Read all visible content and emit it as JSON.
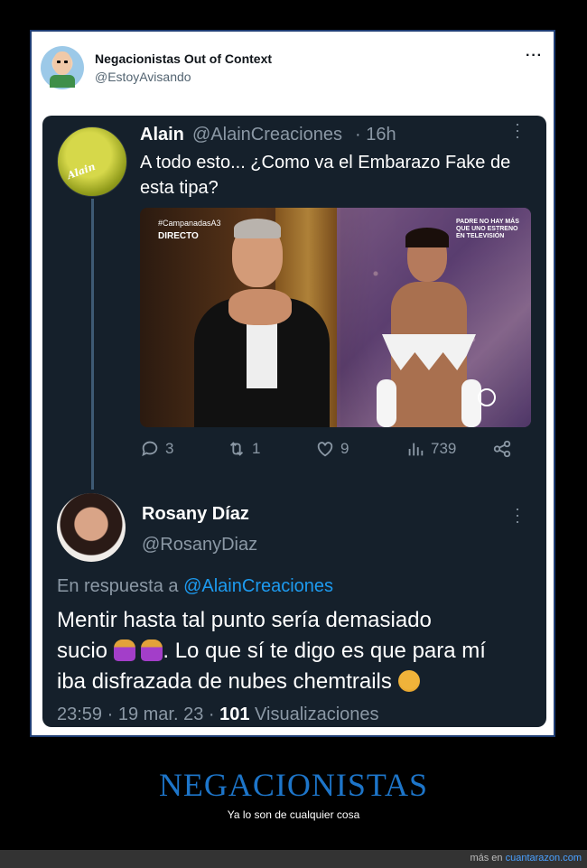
{
  "outer_tweet": {
    "name": "Negacionistas Out of Context",
    "handle": "@EstoyAvisando",
    "more_icon": "more-horizontal-icon"
  },
  "quoted": {
    "author": {
      "name": "Alain",
      "handle": "@AlainCreaciones",
      "time": "· 16h",
      "avatar_text": "Alain"
    },
    "text": "A todo esto... ¿Como va el Embarazo Fake de esta tipa?",
    "media": {
      "hashtag": "#CampanadasA3",
      "live": "DIRECTO",
      "corner": "PADRE NO HAY MÁS QUE UNO ESTRENO EN TELEVISIÓN"
    },
    "actions": {
      "replies": "3",
      "retweets": "1",
      "likes": "9",
      "views": "739"
    }
  },
  "reply": {
    "name": "Rosany Díaz",
    "handle": "@RosanyDiaz",
    "in_reply_prefix": "En respuesta a",
    "in_reply_mention": "@AlainCreaciones",
    "text_line1": "Mentir hasta  tal punto sería demasiado",
    "text_line2_a": "sucio",
    "text_line2_b": ". Lo que sí te digo es que para mí",
    "text_line3": "iba disfrazada de nubes chemtrails",
    "time": "23:59 · 19 mar. 23 ·",
    "views_count": "101",
    "views_label": "Visualizaciones"
  },
  "caption": {
    "title": "NEGACIONISTAS",
    "subtitle": "Ya lo son de cualquier cosa"
  },
  "footer": {
    "prefix": "más en",
    "site": "cuantarazon.com"
  },
  "colors": {
    "accent": "#1d9bf0",
    "card_bg": "#15202b",
    "title_blue": "#1d75c9"
  }
}
